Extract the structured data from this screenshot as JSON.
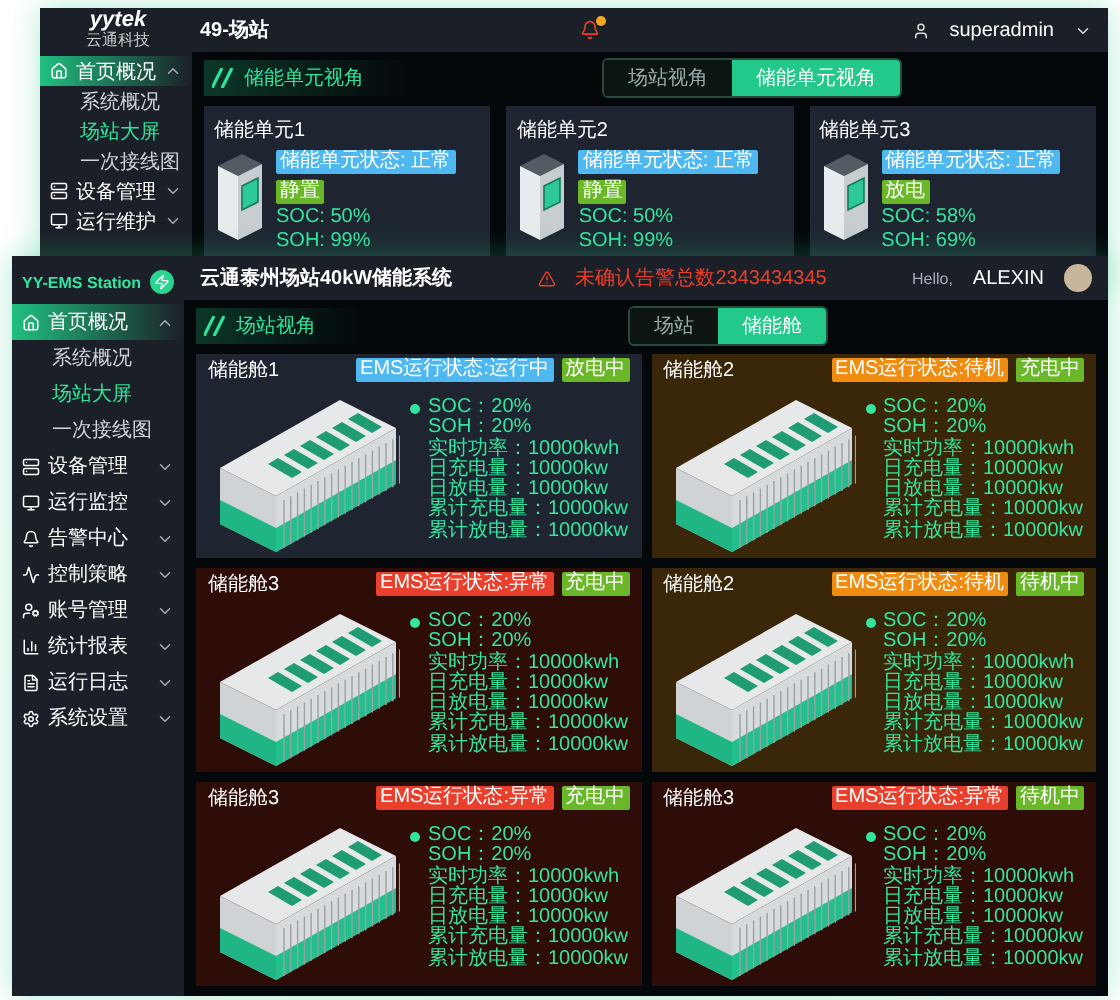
{
  "back_window": {
    "logo": {
      "wordmark": "yytek",
      "subtitle": "云通科技"
    },
    "title": "49-场站",
    "user": "superadmin",
    "sidebar": [
      {
        "label": "首页概况",
        "selected": true,
        "expanded": true,
        "children": [
          {
            "label": "系统概况",
            "selected": false
          },
          {
            "label": "场站大屏",
            "selected": true
          },
          {
            "label": "一次接线图",
            "selected": false
          }
        ]
      },
      {
        "label": "设备管理",
        "selected": false,
        "expanded": false
      },
      {
        "label": "运行维护",
        "selected": false,
        "expanded": false
      }
    ],
    "section_title": "储能单元视角",
    "view_tabs": [
      {
        "label": "场站视角",
        "selected": false
      },
      {
        "label": "储能单元视角",
        "selected": true
      }
    ],
    "units": [
      {
        "name": "储能单元1",
        "status": "储能单元状态: 正常",
        "mode": "静置",
        "soc": "SOC: 50%",
        "soh": "SOH: 99%"
      },
      {
        "name": "储能单元2",
        "status": "储能单元状态: 正常",
        "mode": "静置",
        "soc": "SOC: 50%",
        "soh": "SOH: 99%"
      },
      {
        "name": "储能单元3",
        "status": "储能单元状态: 正常",
        "mode": "放电",
        "soc": "SOC: 58%",
        "soh": "SOH: 69%"
      }
    ]
  },
  "front_window": {
    "brand": "YY-EMS Station",
    "title": "云通泰州场站40kW储能系统",
    "alarm": "未确认告警总数2343434345",
    "greeting": "Hello,",
    "user": "ALEXIN",
    "sidebar": [
      {
        "label": "首页概况",
        "selected": true,
        "expanded": true,
        "children": [
          {
            "label": "系统概况",
            "selected": false
          },
          {
            "label": "场站大屏",
            "selected": true
          },
          {
            "label": "一次接线图",
            "selected": false
          }
        ]
      },
      {
        "label": "设备管理",
        "selected": false,
        "expanded": false
      },
      {
        "label": "运行监控",
        "selected": false,
        "expanded": false
      },
      {
        "label": "告警中心",
        "selected": false,
        "expanded": false
      },
      {
        "label": "控制策略",
        "selected": false,
        "expanded": false
      },
      {
        "label": "账号管理",
        "selected": false,
        "expanded": false
      },
      {
        "label": "统计报表",
        "selected": false,
        "expanded": false
      },
      {
        "label": "运行日志",
        "selected": false,
        "expanded": false
      },
      {
        "label": "系统设置",
        "selected": false,
        "expanded": false
      }
    ],
    "section_title": "场站视角",
    "view_tabs": [
      {
        "label": "场站",
        "selected": false
      },
      {
        "label": "储能舱",
        "selected": true
      }
    ],
    "cards": [
      {
        "name": "储能舱1",
        "kind": "running",
        "status": {
          "text": "EMS运行状态:运行中",
          "color": "#4fb8f0"
        },
        "mode": "放电中",
        "stats": [
          "SOC：20%",
          "SOH：20%",
          "实时功率：10000kwh",
          "日充电量：10000kw",
          "日放电量：10000kw",
          "累计充电量：10000kw",
          "累计放电量：10000kw"
        ]
      },
      {
        "name": "储能舱2",
        "kind": "standby",
        "status": {
          "text": "EMS运行状态:待机",
          "color": "#f08c10"
        },
        "mode": "充电中",
        "stats": [
          "SOC：20%",
          "SOH：20%",
          "实时功率：10000kwh",
          "日充电量：10000kw",
          "日放电量：10000kw",
          "累计充电量：10000kw",
          "累计放电量：10000kw"
        ]
      },
      {
        "name": "储能舱3",
        "kind": "fault",
        "status": {
          "text": "EMS运行状态:异常",
          "color": "#e8402c"
        },
        "mode": "充电中",
        "stats": [
          "SOC：20%",
          "SOH：20%",
          "实时功率：10000kwh",
          "日充电量：10000kw",
          "日放电量：10000kw",
          "累计充电量：10000kw",
          "累计放电量：10000kw"
        ]
      },
      {
        "name": "储能舱2",
        "kind": "standby",
        "status": {
          "text": "EMS运行状态:待机",
          "color": "#f08c10"
        },
        "mode": "待机中",
        "stats": [
          "SOC：20%",
          "SOH：20%",
          "实时功率：10000kwh",
          "日充电量：10000kw",
          "日放电量：10000kw",
          "累计充电量：10000kw",
          "累计放电量：10000kw"
        ]
      },
      {
        "name": "储能舱3",
        "kind": "fault",
        "status": {
          "text": "EMS运行状态:异常",
          "color": "#e8402c"
        },
        "mode": "充电中",
        "stats": [
          "SOC：20%",
          "SOH：20%",
          "实时功率：10000kwh",
          "日充电量：10000kw",
          "日放电量：10000kw",
          "累计充电量：10000kw",
          "累计放电量：10000kw"
        ]
      },
      {
        "name": "储能舱3",
        "kind": "fault",
        "status": {
          "text": "EMS运行状态:异常",
          "color": "#e8402c"
        },
        "mode": "待机中",
        "stats": [
          "SOC：20%",
          "SOH：20%",
          "实时功率：10000kwh",
          "日充电量：10000kw",
          "日放电量：10000kw",
          "累计充电量：10000kw",
          "累计放电量：10000kw"
        ]
      }
    ]
  }
}
